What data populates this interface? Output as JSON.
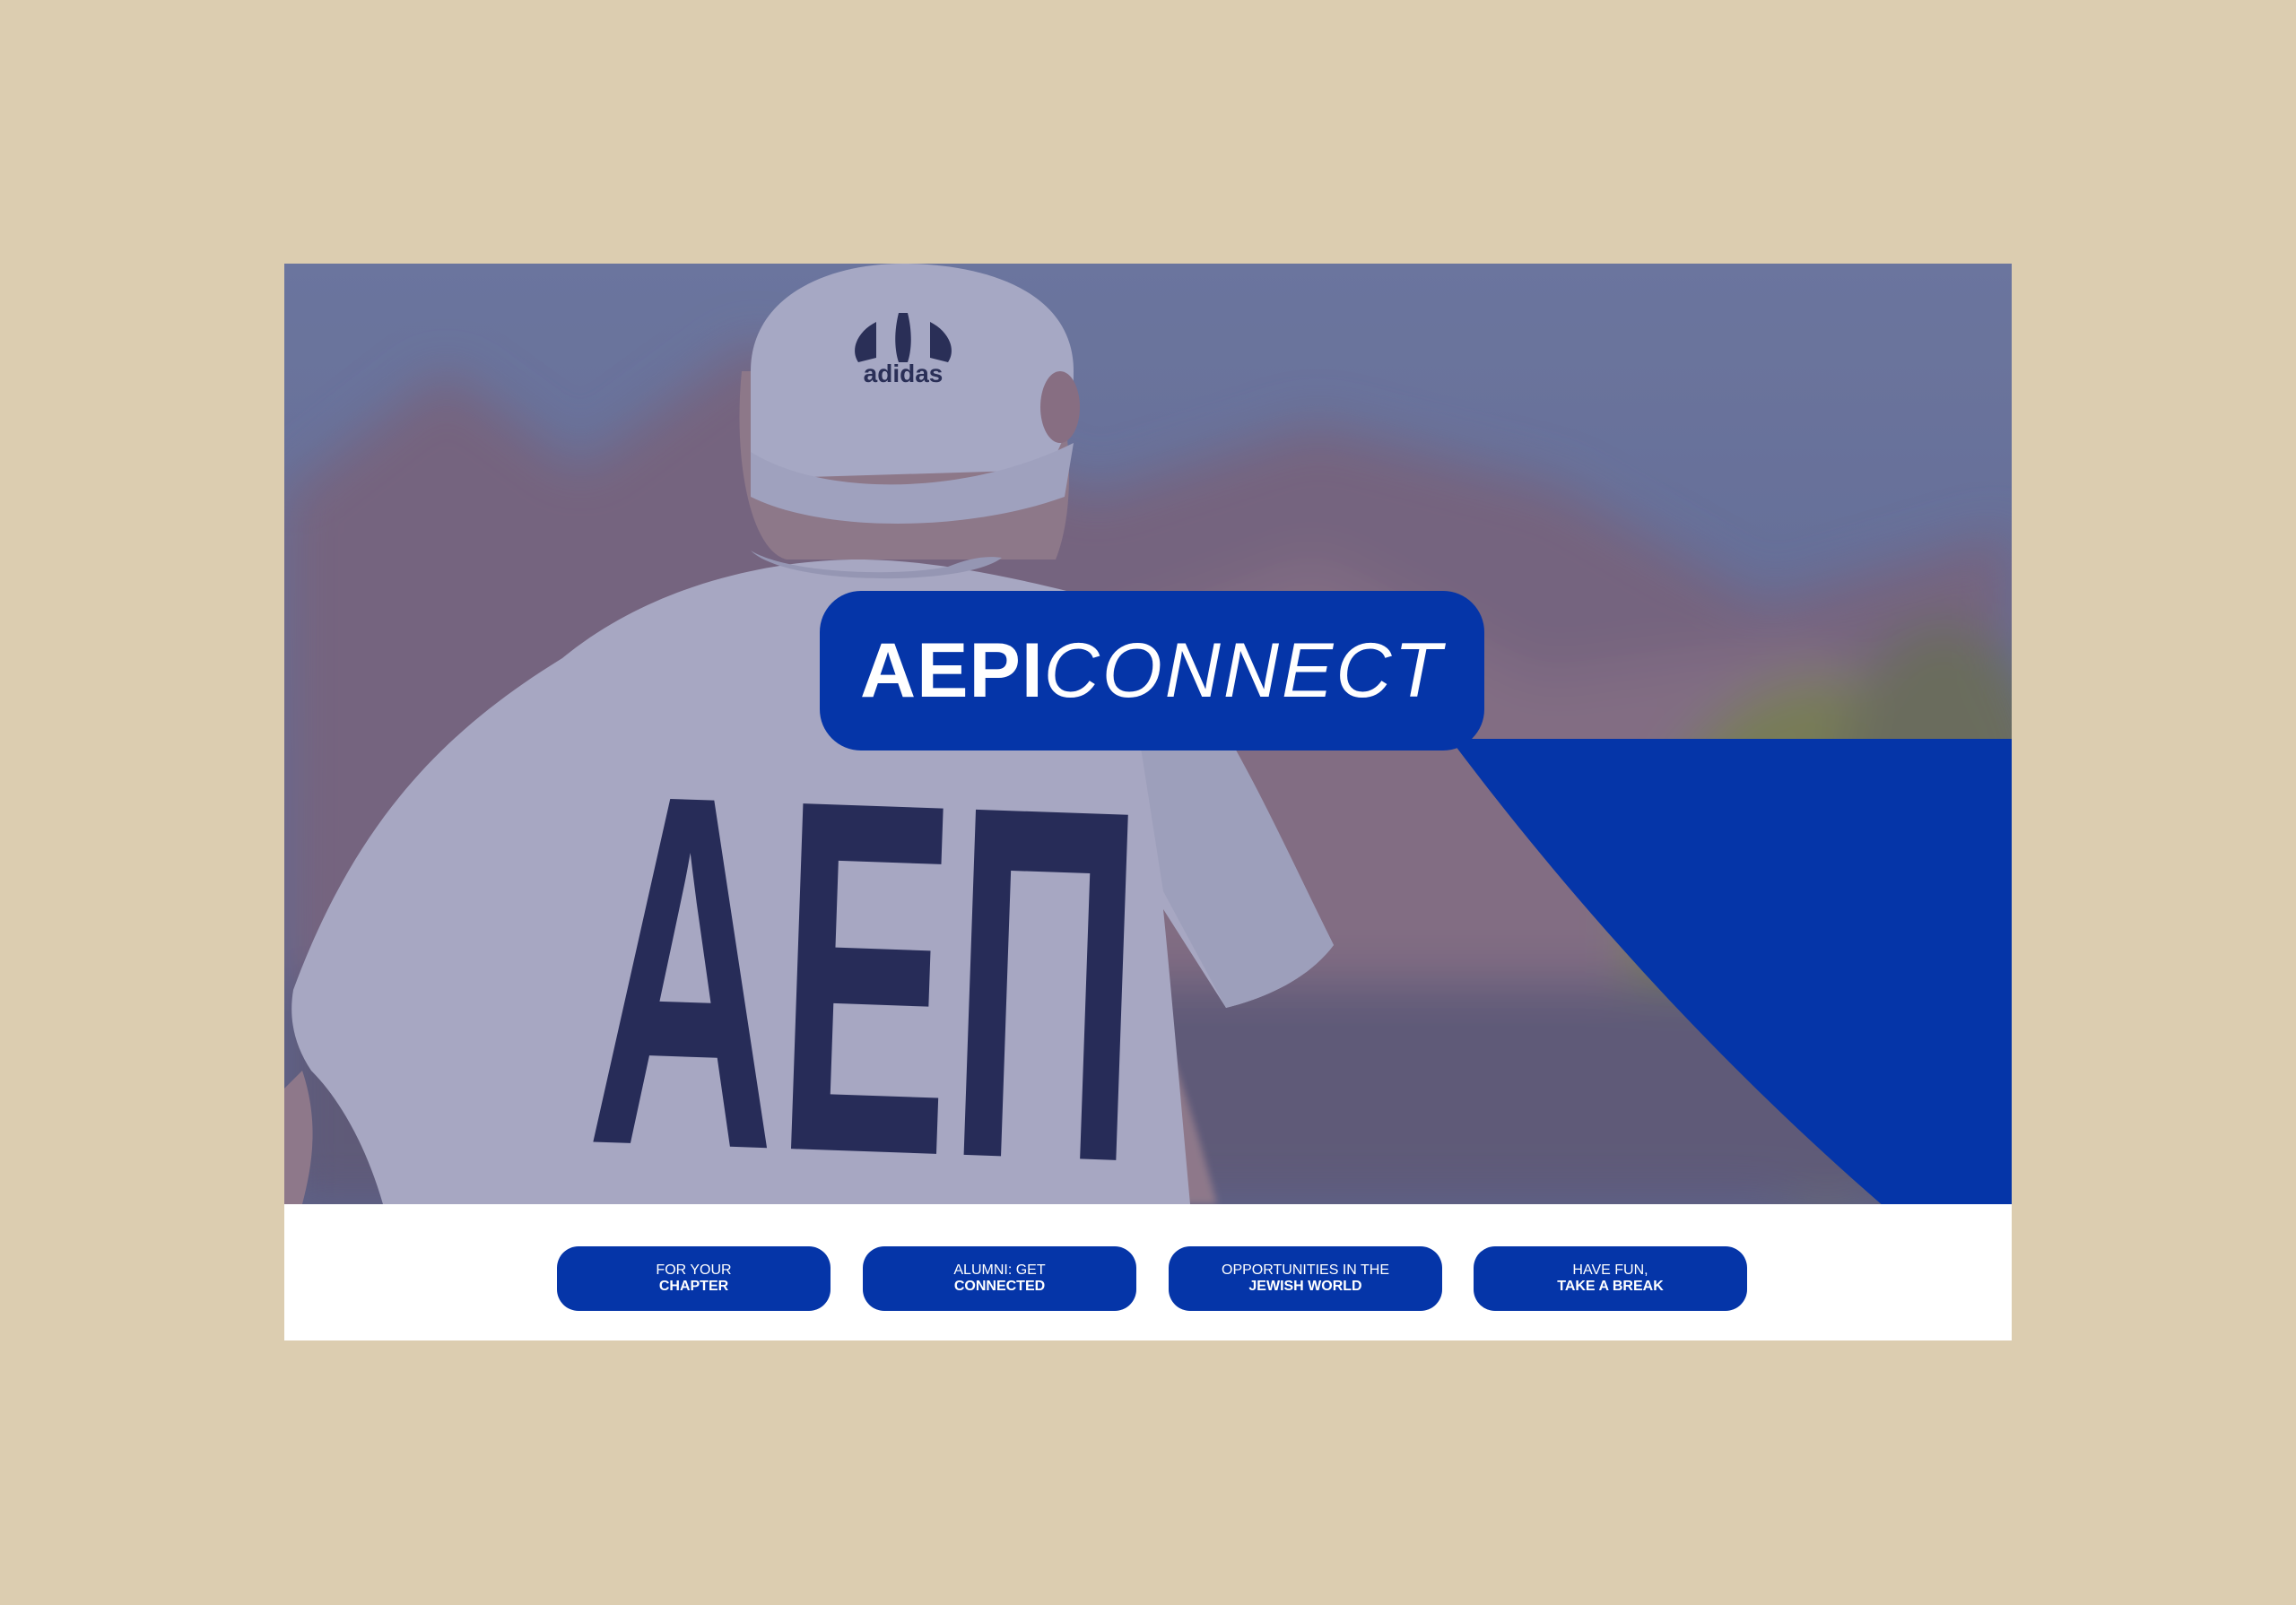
{
  "logo": {
    "bold_text": "AEPI",
    "thin_text": "CONNECT"
  },
  "hero": {
    "cap_brand": "adidas",
    "shirt_letters": "AEΠ"
  },
  "buttons": [
    {
      "line1": "FOR YOUR",
      "line2": "CHAPTER"
    },
    {
      "line1": "ALUMNI: GET",
      "line2": "CONNECTED"
    },
    {
      "line1": "OPPORTUNITIES IN THE",
      "line2": "JEWISH WORLD"
    },
    {
      "line1": "HAVE FUN,",
      "line2": "TAKE A BREAK"
    }
  ],
  "colors": {
    "page_background": "#dccdb0",
    "brand_blue": "#0535a8",
    "hero_overlay": "#2c3a7a",
    "button_text": "#ffffff"
  }
}
